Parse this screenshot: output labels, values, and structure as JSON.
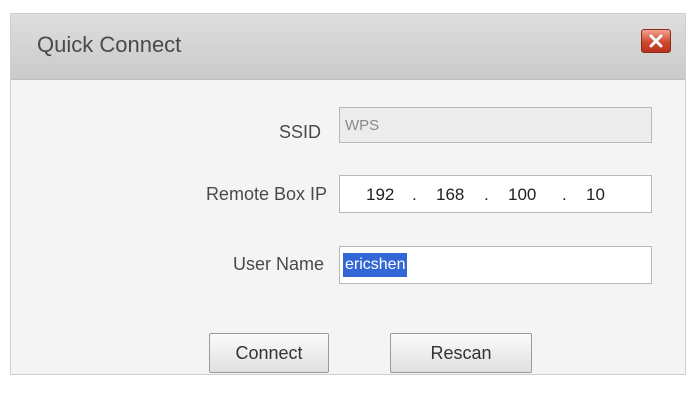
{
  "dialog": {
    "title": "Quick Connect",
    "close_icon": "close-icon"
  },
  "fields": {
    "ssid": {
      "label": "SSID",
      "value": "WPS"
    },
    "remote_ip": {
      "label": "Remote Box IP",
      "octets": [
        "192",
        "168",
        "100",
        "10"
      ],
      "separator": "."
    },
    "user_name": {
      "label": "User Name",
      "value": "ericshen"
    }
  },
  "buttons": {
    "connect": "Connect",
    "rescan": "Rescan"
  },
  "colors": {
    "selection_highlight": "#3367d6",
    "close_button": "#d2482e"
  }
}
